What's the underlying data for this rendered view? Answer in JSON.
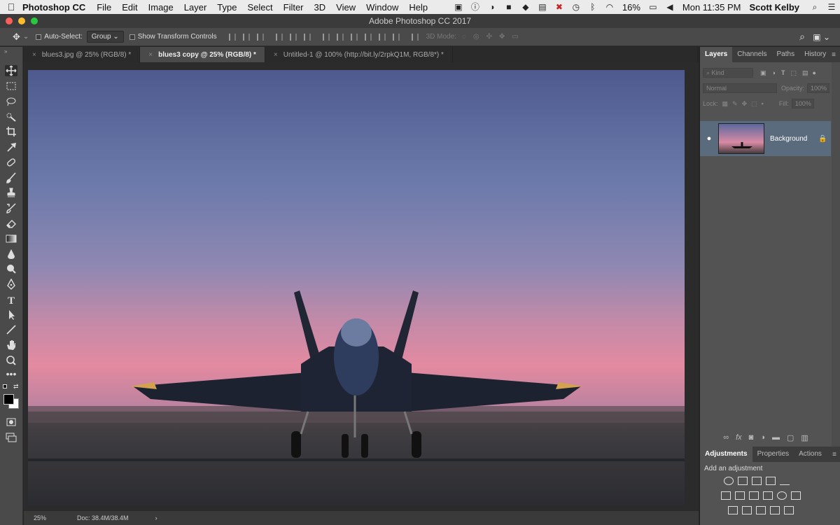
{
  "menubar": {
    "apple": "",
    "app_name": "Photoshop CC",
    "items": [
      "File",
      "Edit",
      "Image",
      "Layer",
      "Type",
      "Select",
      "Filter",
      "3D",
      "View",
      "Window",
      "Help"
    ],
    "battery": "16%",
    "clock": "Mon 11:35 PM",
    "user": "Scott Kelby"
  },
  "window": {
    "title": "Adobe Photoshop CC 2017"
  },
  "options_bar": {
    "auto_select_label": "Auto-Select:",
    "auto_select_value": "Group",
    "show_transform_label": "Show Transform Controls",
    "mode_3d": "3D Mode:"
  },
  "tabs": [
    {
      "label": "blues3.jpg @ 25% (RGB/8) *",
      "active": false
    },
    {
      "label": "blues3 copy @ 25% (RGB/8) *",
      "active": true
    },
    {
      "label": "Untitled-1 @ 100% (http://bit.ly/2rpkQ1M, RGB/8*) *",
      "active": false
    }
  ],
  "status": {
    "zoom": "25%",
    "doc": "Doc: 38.4M/38.4M",
    "arrow": "›"
  },
  "layers_panel": {
    "tabs": [
      "Layers",
      "Channels",
      "Paths",
      "History"
    ],
    "kind": "Kind",
    "blend_mode": "Normal",
    "opacity_label": "Opacity:",
    "opacity_value": "100%",
    "lock_label": "Lock:",
    "fill_label": "Fill:",
    "fill_value": "100%",
    "layer_name": "Background"
  },
  "adjustments_panel": {
    "tabs": [
      "Adjustments",
      "Properties",
      "Actions"
    ],
    "heading": "Add an adjustment"
  }
}
